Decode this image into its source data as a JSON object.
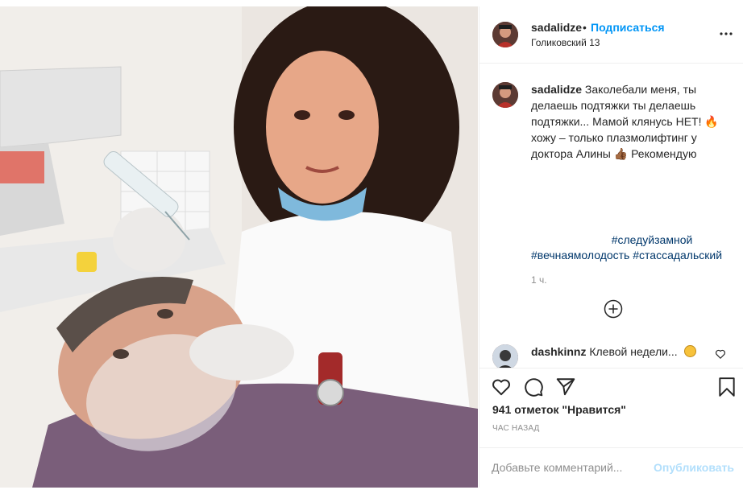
{
  "header": {
    "username": "sadalidze",
    "separator": "•",
    "follow_label": "Подписаться",
    "location": "Голиковский 13"
  },
  "caption": {
    "username": "sadalidze",
    "text": "Заколебали меня, ты делаешь подтяжки ты делаешь подтяжки... Мамой клянусь НЕТ! 🔥 хожу – только плазмолифтинг у доктора Алины 👍🏾 Рекомендую",
    "hashtags_line1": "#следуйзамной",
    "hashtags_line2": "#вечнаямолодость #стассадальский",
    "time": "1 ч."
  },
  "comment": {
    "username": "dashkinnz",
    "text": "Клевой недели..."
  },
  "stats": {
    "likes": "941 отметок \"Нравится\"",
    "ago": "ЧАС НАЗАД"
  },
  "add_comment": {
    "placeholder": "Добавьте комментарий...",
    "publish_label": "Опубликовать"
  },
  "colors": {
    "accent": "#0095f6",
    "hashtag": "#00376b",
    "muted": "#8e8e8e",
    "publish_disabled": "#b2dffc"
  }
}
